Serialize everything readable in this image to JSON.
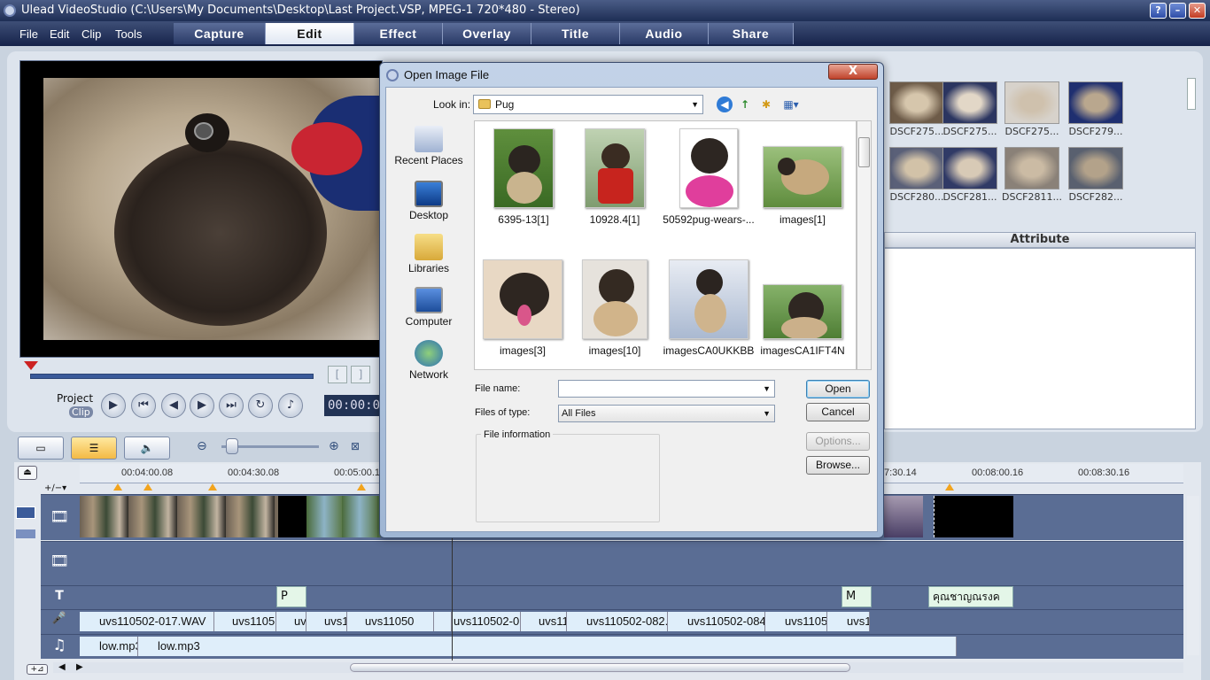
{
  "window": {
    "title": "Ulead VideoStudio (C:\\Users\\My Documents\\Desktop\\Last Project.VSP, MPEG-1 720*480 - Stereo)",
    "help": "?",
    "minimize": "–",
    "restore": "▫",
    "close": "✕"
  },
  "menu": [
    "File",
    "Edit",
    "Clip",
    "Tools"
  ],
  "steps": [
    "Capture",
    "Edit",
    "Effect",
    "Overlay",
    "Title",
    "Audio",
    "Share"
  ],
  "player": {
    "project_label": "Project",
    "clip_label": "Clip",
    "timecode": "00:00:0",
    "bracket_in": "[",
    "bracket_out": "]"
  },
  "library": {
    "row1": [
      "DSCF275...",
      "DSCF275...",
      "DSCF275...",
      "DSCF279..."
    ],
    "row2": [
      "DSCF280...",
      "DSCF281...",
      "DSCF2811...",
      "DSCF282..."
    ],
    "attribute_tab": "Attribute"
  },
  "timeline": {
    "ticks": [
      "00:04:00.08",
      "00:04:30.08",
      "00:05:00.1",
      "7:30.14",
      "00:08:00.16",
      "00:08:30.16"
    ],
    "title_clips": [
      "P",
      "M",
      "คุณชาญณรงค"
    ],
    "voice_clips": [
      "uvs110502-017.WAV",
      "uvs1105",
      "uv",
      "uvs1",
      "uvs11050",
      "uvs110502-0",
      "uvs11",
      "uvs110502-082.",
      "uvs110502-084",
      "uvs1105",
      "uvs1"
    ],
    "music_clips": [
      "low.mp3",
      "low.mp3"
    ],
    "track_glyphs": {
      "video": "🎞",
      "overlay": "🎞",
      "title": "T",
      "voice": "🎤",
      "music": "♫"
    }
  },
  "dialog": {
    "title": "Open Image File",
    "close": "X",
    "look_in_label": "Look in:",
    "look_in_value": "Pug",
    "places": [
      "Recent Places",
      "Desktop",
      "Libraries",
      "Computer",
      "Network"
    ],
    "files": [
      "6395-13[1]",
      "10928.4[1]",
      "50592pug-wears-...",
      "images[1]",
      "images[3]",
      "images[10]",
      "imagesCA0UKKBB",
      "imagesCA1IFT4N"
    ],
    "file_name_label": "File name:",
    "file_name_value": "",
    "file_type_label": "Files of type:",
    "file_type_value": "All Files",
    "file_info_label": "File information",
    "buttons": {
      "open": "Open",
      "cancel": "Cancel",
      "options": "Options...",
      "browse": "Browse..."
    }
  },
  "colors": {
    "accent": "#2a3a66",
    "track": "#5a6d94",
    "clip": "#dfeefa"
  }
}
